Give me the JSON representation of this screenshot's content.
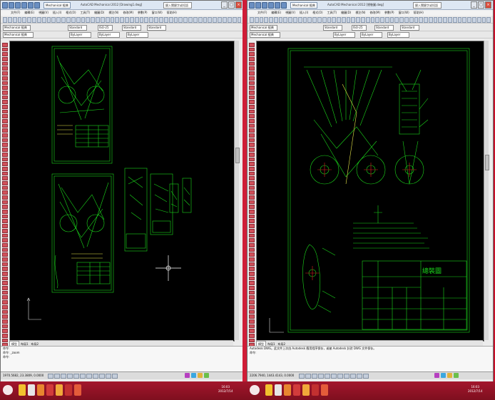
{
  "left_window": {
    "title": "AutoCAD Mechanical 2012  [Drawing1.dwg]",
    "workspace": "Mechanical 經典",
    "find_placeholder": "鍵入關鍵字或短語",
    "menus": [
      "文件(F)",
      "編輯(E)",
      "視圖(V)",
      "插入(I)",
      "格式(O)",
      "工具(T)",
      "繪圖(D)",
      "標注(N)",
      "修改(M)",
      "參數(P)",
      "窗口(W)",
      "幫助(H)"
    ],
    "toolbar_style": "Standard",
    "toolbar_dim": "ISO-25",
    "layer_name": "Mechanical 經典",
    "bylayer": "ByLayer",
    "tabs": [
      "模型",
      "布局1",
      "布局2"
    ],
    "command_history": [
      "命令:",
      "命令: _zoom"
    ],
    "command_prompt": "命令:",
    "coordinates": "1970.5682, 23.3809, 0.0000",
    "clock_time": "16:03",
    "clock_date": "2012/7/14"
  },
  "right_window": {
    "title": "AutoCAD Mechanical 2012  [總裝圖.dwg]",
    "workspace": "Mechanical 經典",
    "find_placeholder": "鍵入關鍵字或短語",
    "menus": [
      "文件(F)",
      "編輯(E)",
      "視圖(V)",
      "插入(I)",
      "格式(O)",
      "工具(T)",
      "繪圖(D)",
      "標注(N)",
      "修改(M)",
      "參數(P)",
      "窗口(W)",
      "幫助(H)"
    ],
    "toolbar_style": "Standard",
    "toolbar_dim": "ISO-25",
    "bylayer": "ByLayer",
    "tabs": [
      "模型",
      "布局1",
      "布局2"
    ],
    "command_history": [
      "Autodesk DWG。此文件上次由 Autodesk 應用程序保存，或被 Autodesk 針對 DWG 文件保存。"
    ],
    "command_prompt": "命令:",
    "coordinates": "2206.7940, 1443.4143, 0.0000",
    "title_block_label": "總裝圖",
    "clock_time": "16:03",
    "clock_date": "2012/7/14"
  },
  "colors": {
    "cad_green": "#1bd81b",
    "cad_yellow": "#e8e84a",
    "cad_red": "#e02020",
    "taskbar_red": "#a3162c"
  }
}
